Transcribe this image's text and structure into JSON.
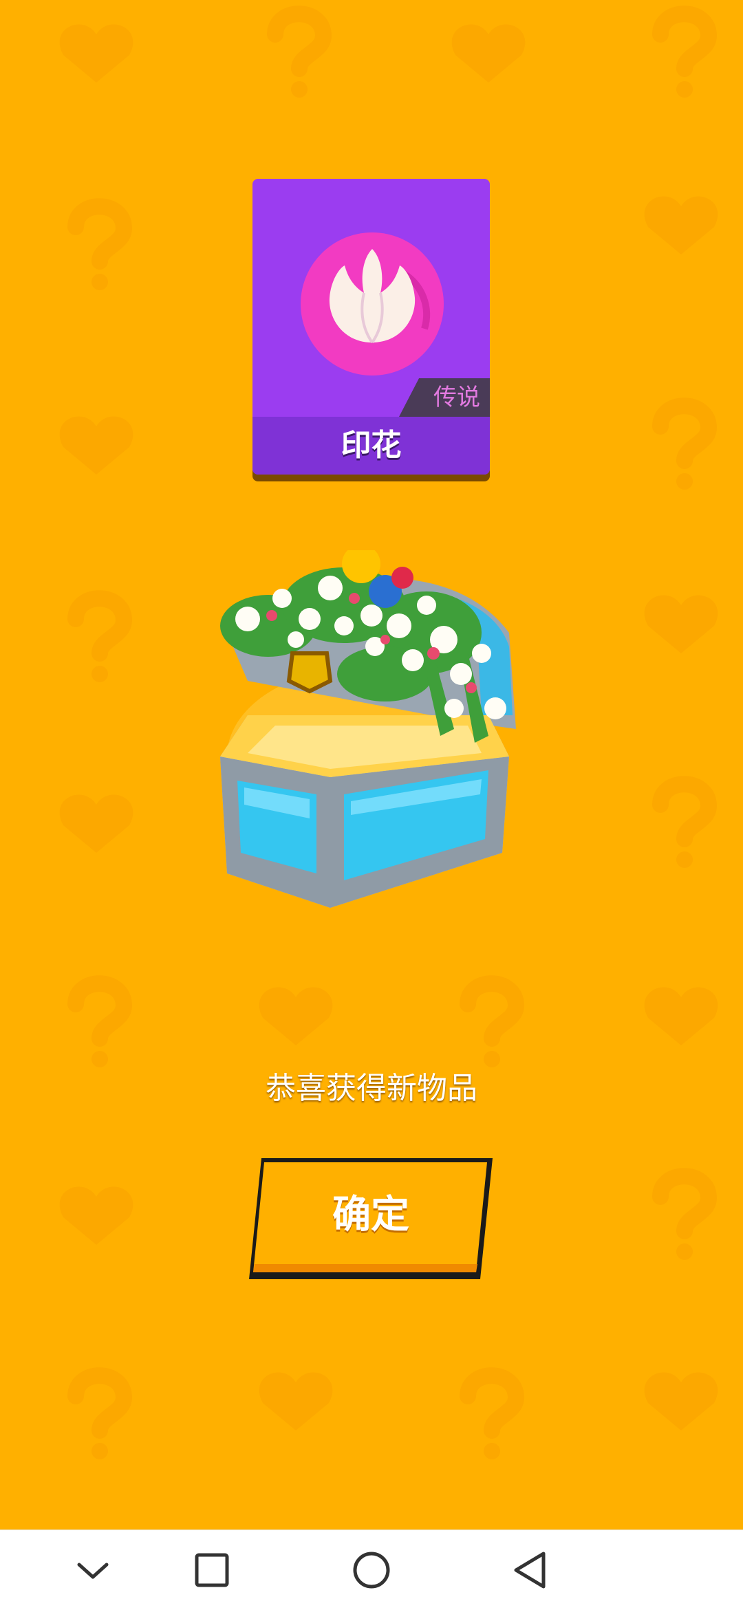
{
  "card": {
    "name": "印花",
    "rarity": "传说",
    "background_color": "#9B3DF0",
    "icon": "tulip-icon"
  },
  "reward": {
    "illustration": "flower-treasure-chest",
    "message": "恭喜获得新物品"
  },
  "confirm_button": {
    "label": "确定"
  },
  "navbar": {
    "buttons": [
      "chevron-down-icon",
      "recents-square-icon",
      "home-circle-icon",
      "back-triangle-icon"
    ]
  },
  "colors": {
    "background": "#FFB000",
    "accent": "#FF9E00"
  }
}
